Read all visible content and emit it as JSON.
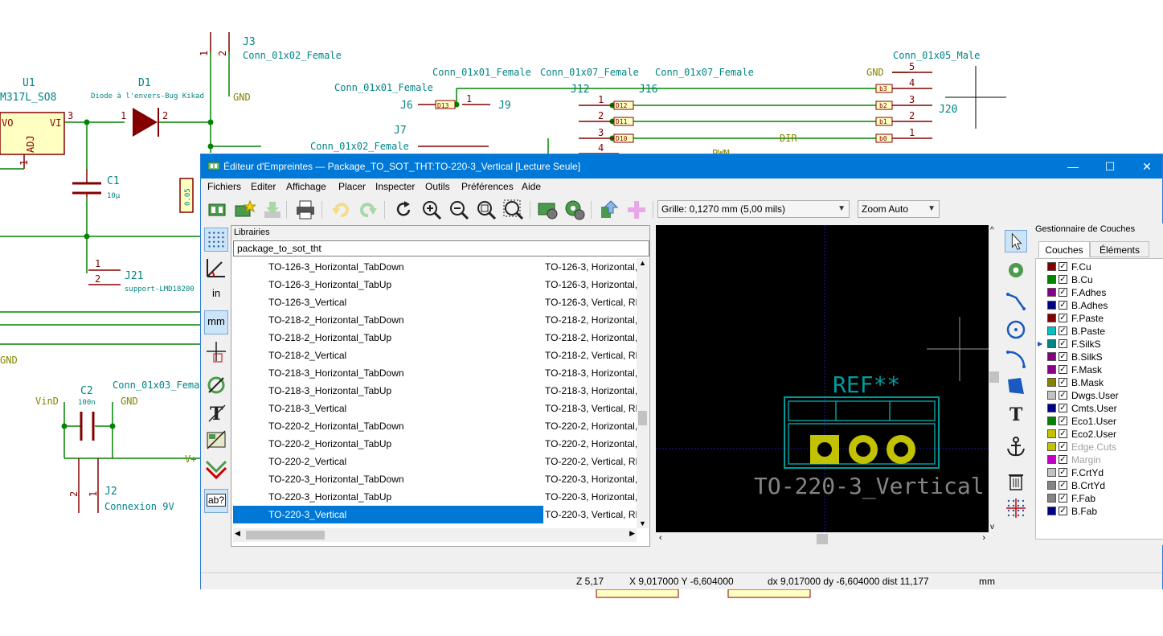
{
  "schematic": {
    "labels": {
      "u1_ref": "U1",
      "u1_value": "M317L_SO8",
      "u1_pin_vo": "VO",
      "u1_pin_vi": "VI",
      "u1_pin_adj": "ADJ",
      "u1_pin3": "3",
      "u1_pin1": "1",
      "d1_ref": "D1",
      "d1_value": "Diode à l'envers-Bug Kikad",
      "d1_pin1": "1",
      "d1_pin2": "2",
      "j3_ref": "J3",
      "j3_value": "Conn_01x02_Female",
      "j3_pin1": "1",
      "j3_pin2": "2",
      "gnd1": "GND",
      "gnd2": "GND",
      "gnd3": "GND",
      "gnd4": "GND",
      "c1_ref": "C1",
      "c1_value": "10µ",
      "r_value": "0.05",
      "j21_ref": "J21",
      "j21_value": "support-LMD18200",
      "j21_pin1": "1",
      "j21_pin2": "2",
      "c2_ref": "C2",
      "c2_value": "100n",
      "c2_conn": "Conn_01x03_Fema",
      "vin": "VinD",
      "vplus": "V+",
      "j2_ref": "J2",
      "j2_value": "Connexion 9V",
      "j2_pin1": "1",
      "j2_pin2": "2",
      "j6_ref": "J6",
      "j6_conn": "Conn_01x01_Female",
      "j6_net": "D13",
      "j9_ref": "J9",
      "j9_conn": "Conn_01x01_Female",
      "j7_ref": "J7",
      "j7_conn": "Conn_01x02_Female",
      "j12_ref": "J12",
      "j12_conn": "Conn_01x07_Female",
      "j16_ref": "J16",
      "j16_conn": "Conn_01x07_Female",
      "j20_ref": "J20",
      "j20_conn": "Conn_01x05_Male",
      "dir": "DIR",
      "pwm": "PWM",
      "net_d12": "D12",
      "net_d11": "D11",
      "net_d10": "D10",
      "net_b3": "b3",
      "net_b2": "b2",
      "net_b1": "b1",
      "net_b0": "b0",
      "pin5": "5",
      "pin4": "4",
      "pin3": "3",
      "pin2": "2",
      "pin1": "1"
    }
  },
  "window": {
    "title": "Éditeur d'Empreintes — Package_TO_SOT_THT:TO-220-3_Vertical [Lecture Seule]",
    "controls": {
      "minimize": "—",
      "maximize": "☐",
      "close": "✕"
    }
  },
  "menu": [
    "Fichiers",
    "Editer",
    "Affichage",
    "Placer",
    "Inspecter",
    "Outils",
    "Préférences",
    "Aide"
  ],
  "toolbar": {
    "grid_select": "Grille: 0,1270 mm (5,00 mils)",
    "zoom_select": "Zoom Auto",
    "icons": [
      "new-footprint-icon",
      "load-footprint-icon",
      "save-icon",
      "print-icon",
      "undo-icon",
      "redo-icon",
      "refresh-icon",
      "zoom-in-icon",
      "zoom-out-icon",
      "zoom-fit-icon",
      "zoom-selection-icon",
      "footprint-properties-icon",
      "pad-settings-icon",
      "check-footprint-icon",
      "insert-footprint-icon"
    ]
  },
  "left_tools": {
    "inch_label": "in",
    "mm_label": "mm",
    "abbr_label": "ab?"
  },
  "library": {
    "header": "Librairies",
    "search": "package_to_sot_tht",
    "rows": [
      {
        "name": "TO-126-3_Horizontal_TabDown",
        "desc": "TO-126-3, Horizontal,"
      },
      {
        "name": "TO-126-3_Horizontal_TabUp",
        "desc": "TO-126-3, Horizontal,"
      },
      {
        "name": "TO-126-3_Vertical",
        "desc": "TO-126-3, Vertical, RM"
      },
      {
        "name": "TO-218-2_Horizontal_TabDown",
        "desc": "TO-218-2, Horizontal,"
      },
      {
        "name": "TO-218-2_Horizontal_TabUp",
        "desc": "TO-218-2, Horizontal,"
      },
      {
        "name": "TO-218-2_Vertical",
        "desc": "TO-218-2, Vertical, RM"
      },
      {
        "name": "TO-218-3_Horizontal_TabDown",
        "desc": "TO-218-3, Horizontal,"
      },
      {
        "name": "TO-218-3_Horizontal_TabUp",
        "desc": "TO-218-3, Horizontal,"
      },
      {
        "name": "TO-218-3_Vertical",
        "desc": "TO-218-3, Vertical, RM"
      },
      {
        "name": "TO-220-2_Horizontal_TabDown",
        "desc": "TO-220-2, Horizontal,"
      },
      {
        "name": "TO-220-2_Horizontal_TabUp",
        "desc": "TO-220-2, Horizontal,"
      },
      {
        "name": "TO-220-2_Vertical",
        "desc": "TO-220-2, Vertical, RM"
      },
      {
        "name": "TO-220-3_Horizontal_TabDown",
        "desc": "TO-220-3, Horizontal,"
      },
      {
        "name": "TO-220-3_Horizontal_TabUp",
        "desc": "TO-220-3, Horizontal,"
      },
      {
        "name": "TO-220-3_Vertical",
        "desc": "TO-220-3, Vertical, RM",
        "selected": true
      }
    ],
    "selected_index": 14
  },
  "canvas": {
    "ref_text": "REF**",
    "value_text": "TO-220-3_Vertical",
    "colors": {
      "background": "#000000",
      "silk": "#009c9c",
      "pad": "#c2c200"
    }
  },
  "layers_panel": {
    "header": "Gestionnaire de Couches",
    "tabs": [
      "Couches",
      "Éléments"
    ],
    "active_tab": 0,
    "layers": [
      {
        "name": "F.Cu",
        "color": "#840000",
        "checked": true
      },
      {
        "name": "B.Cu",
        "color": "#008400",
        "checked": true
      },
      {
        "name": "F.Adhes",
        "color": "#840084",
        "checked": true
      },
      {
        "name": "B.Adhes",
        "color": "#000084",
        "checked": true
      },
      {
        "name": "F.Paste",
        "color": "#840000",
        "checked": true
      },
      {
        "name": "B.Paste",
        "color": "#00c2c2",
        "checked": true
      },
      {
        "name": "F.SilkS",
        "color": "#008484",
        "checked": true,
        "current": true
      },
      {
        "name": "B.SilkS",
        "color": "#840084",
        "checked": true
      },
      {
        "name": "F.Mask",
        "color": "#840084",
        "checked": true
      },
      {
        "name": "B.Mask",
        "color": "#848400",
        "checked": true
      },
      {
        "name": "Dwgs.User",
        "color": "#c2c2c2",
        "checked": true
      },
      {
        "name": "Cmts.User",
        "color": "#000084",
        "checked": true
      },
      {
        "name": "Eco1.User",
        "color": "#008400",
        "checked": true
      },
      {
        "name": "Eco2.User",
        "color": "#c2c200",
        "checked": true
      },
      {
        "name": "Edge.Cuts",
        "color": "#c2c200",
        "checked": true,
        "dim": true
      },
      {
        "name": "Margin",
        "color": "#c200c2",
        "checked": true,
        "dim": true
      },
      {
        "name": "F.CrtYd",
        "color": "#c2c2c2",
        "checked": true
      },
      {
        "name": "B.CrtYd",
        "color": "#848484",
        "checked": true
      },
      {
        "name": "F.Fab",
        "color": "#848484",
        "checked": true
      },
      {
        "name": "B.Fab",
        "color": "#000084",
        "checked": true
      }
    ]
  },
  "status": {
    "zoom": "Z 5,17",
    "xy": "X 9,017000  Y -6,604000",
    "delta": "dx 9,017000  dy -6,604000  dist 11,177",
    "units": "mm"
  }
}
